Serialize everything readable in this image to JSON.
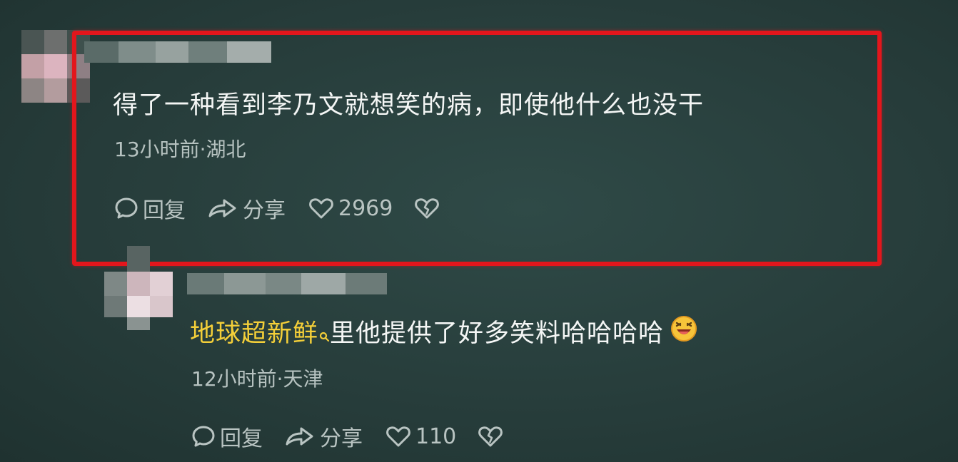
{
  "comment": {
    "text": "得了一种看到李乃文就想笑的病，即使他什么也没干",
    "meta": "13小时前·湖北",
    "actions": {
      "reply_label": "回复",
      "share_label": "分享",
      "like_count": "2969"
    }
  },
  "reply": {
    "mention": "地球超新鲜",
    "text": "里他提供了好多笑料哈哈哈哈",
    "meta": "12小时前·天津",
    "actions": {
      "reply_label": "回复",
      "share_label": "分享",
      "like_count": "110"
    }
  },
  "icons": {
    "reply": "comment-bubble-icon",
    "share": "share-arrow-icon",
    "like": "heart-icon",
    "dislike": "broken-heart-icon",
    "mention_search": "search-icon",
    "emoji": "laughing-emoji-icon"
  },
  "colors": {
    "background": "#273d3b",
    "highlight_border": "#e3161c",
    "mention": "#f4cf39",
    "meta_text": "#b6c2c0"
  }
}
